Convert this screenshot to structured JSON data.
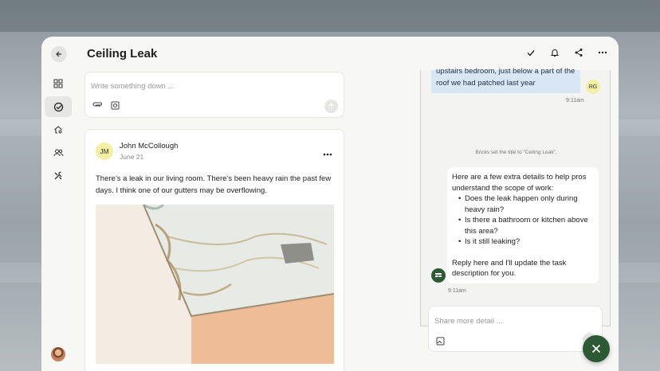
{
  "header": {
    "title": "Ceiling Leak"
  },
  "composer": {
    "placeholder": "Write something down ..."
  },
  "post": {
    "author_initials": "JM",
    "author": "John McCollough",
    "date": "June 21",
    "body": "There’s a leak in our living room. There’s been heavy rain the past few days. I think one of our gutters may be overflowing."
  },
  "chat": {
    "user_message_fragment": "upstairs bedroom, just below a part of the roof we had patched last year",
    "user_initials": "RG",
    "user_time": "9:11am",
    "system_notice": "Bricks set the title to \"Ceiling Leak\".",
    "bot_intro": "Here are a few extra details to help pros understand the scope of work:",
    "bot_questions": [
      "Does the leak happen only during heavy rain?",
      "Is there a bathroom or kitchen above this area?",
      "Is it still leaking?"
    ],
    "bot_outro": "Reply here and I'll update the task description for you.",
    "bot_time": "9:11am",
    "input_placeholder": "Share more detail ..."
  },
  "colors": {
    "accent_green": "#2d5a35",
    "user_bubble": "#d9e6f6",
    "avatar_yellow": "#f3efa3"
  },
  "icons": [
    "arrow-left-icon",
    "check-icon",
    "bell-icon",
    "share-icon",
    "more-horizontal-icon",
    "dashboard-icon",
    "task-check-icon",
    "home-tools-icon",
    "people-icon",
    "tools-icon",
    "paperclip-icon",
    "image-icon",
    "arrow-up-icon",
    "close-icon",
    "bricks-logo-icon"
  ]
}
